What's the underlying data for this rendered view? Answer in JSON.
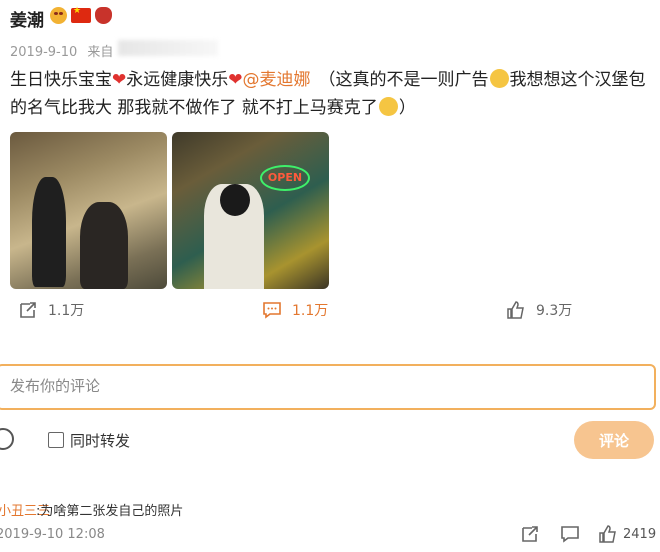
{
  "post": {
    "author": "姜潮",
    "date": "2019-9-10",
    "source_prefix": "来自",
    "text_parts": {
      "p1": "生日快乐宝宝",
      "p2": "永远健康快乐",
      "mention": "@麦迪娜",
      "p3": "（这真的不是一则广告",
      "p4": "我想想这个汉堡包的名气比我大 那我就不做作了 就不打上马赛克了",
      "p5": "）"
    },
    "open_sign": "OPEN",
    "actions": {
      "repost_count": "1.1万",
      "comment_count": "1.1万",
      "like_count": "9.3万"
    }
  },
  "composer": {
    "placeholder": "发布你的评论",
    "also_repost_label": "同时转发",
    "submit_label": "评论"
  },
  "comment": {
    "user": "小丑三三",
    "text": ":为啥第二张发自己的照片",
    "time": "2019-9-10 12:08",
    "like_count": "2419"
  },
  "colors": {
    "accent": "#e3772f",
    "heart": "#e0322f",
    "input_border": "#f2b05d",
    "submit_bg": "#f7c590"
  }
}
